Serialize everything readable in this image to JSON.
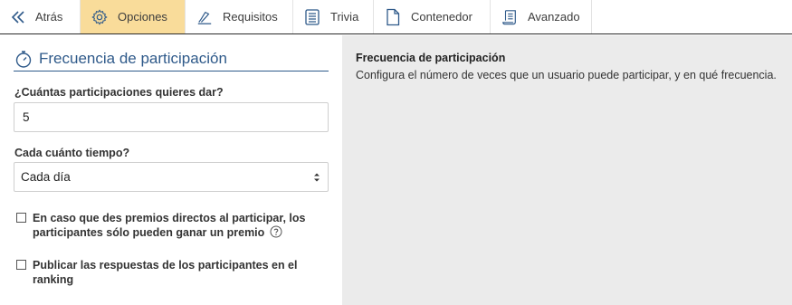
{
  "nav": {
    "back_label": "Atrás",
    "tabs": [
      {
        "label": "Opciones",
        "icon": "gear-icon",
        "active": true
      },
      {
        "label": "Requisitos",
        "icon": "signature-icon",
        "active": false
      },
      {
        "label": "Trivia",
        "icon": "checklist-icon",
        "active": false
      },
      {
        "label": "Contenedor",
        "icon": "document-icon",
        "active": false
      },
      {
        "label": "Avanzado",
        "icon": "scroll-icon",
        "active": false
      }
    ]
  },
  "form": {
    "section_title": "Frecuencia de participación",
    "participations_label": "¿Cuántas participaciones quieres dar?",
    "participations_value": "5",
    "frequency_label": "Cada cuánto tiempo?",
    "frequency_value": "Cada día",
    "checkbox_single_prize_line1": "En caso que des premios directos al participar, los",
    "checkbox_single_prize_line2": "participantes sólo pueden ganar un premio",
    "checkbox_single_prize_checked": false,
    "checkbox_ranking_line1": "Publicar las respuestas de los participantes en el",
    "checkbox_ranking_line2": "ranking",
    "checkbox_ranking_checked": false
  },
  "help_panel": {
    "title": "Frecuencia de participación",
    "description": "Configura el número de veces que un usuario puede participar, y en qué frecuencia."
  },
  "colors": {
    "accent": "#2f5a8a",
    "active_tab": "#f9dc9a",
    "help_bg": "#ebebeb"
  }
}
